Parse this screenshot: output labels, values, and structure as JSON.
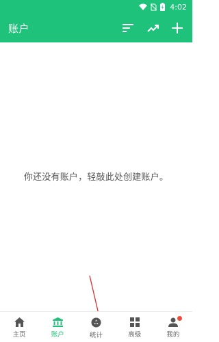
{
  "status_bar": {
    "time": "4:02"
  },
  "app_bar": {
    "title": "账户"
  },
  "empty_state": {
    "message": "你还没有账户，轻敲此处创建账户。"
  },
  "bottom_nav": {
    "items": [
      {
        "label": "主页",
        "icon": "home-icon"
      },
      {
        "label": "账户",
        "icon": "bank-icon",
        "active": true
      },
      {
        "label": "统计",
        "icon": "pie-chart-icon"
      },
      {
        "label": "高级",
        "icon": "grid-icon"
      },
      {
        "label": "我的",
        "icon": "person-icon",
        "badge": true
      }
    ]
  },
  "colors": {
    "primary": "#1fc27b",
    "badge": "#f04a3c",
    "annotation_arrow": "#d9302c"
  }
}
